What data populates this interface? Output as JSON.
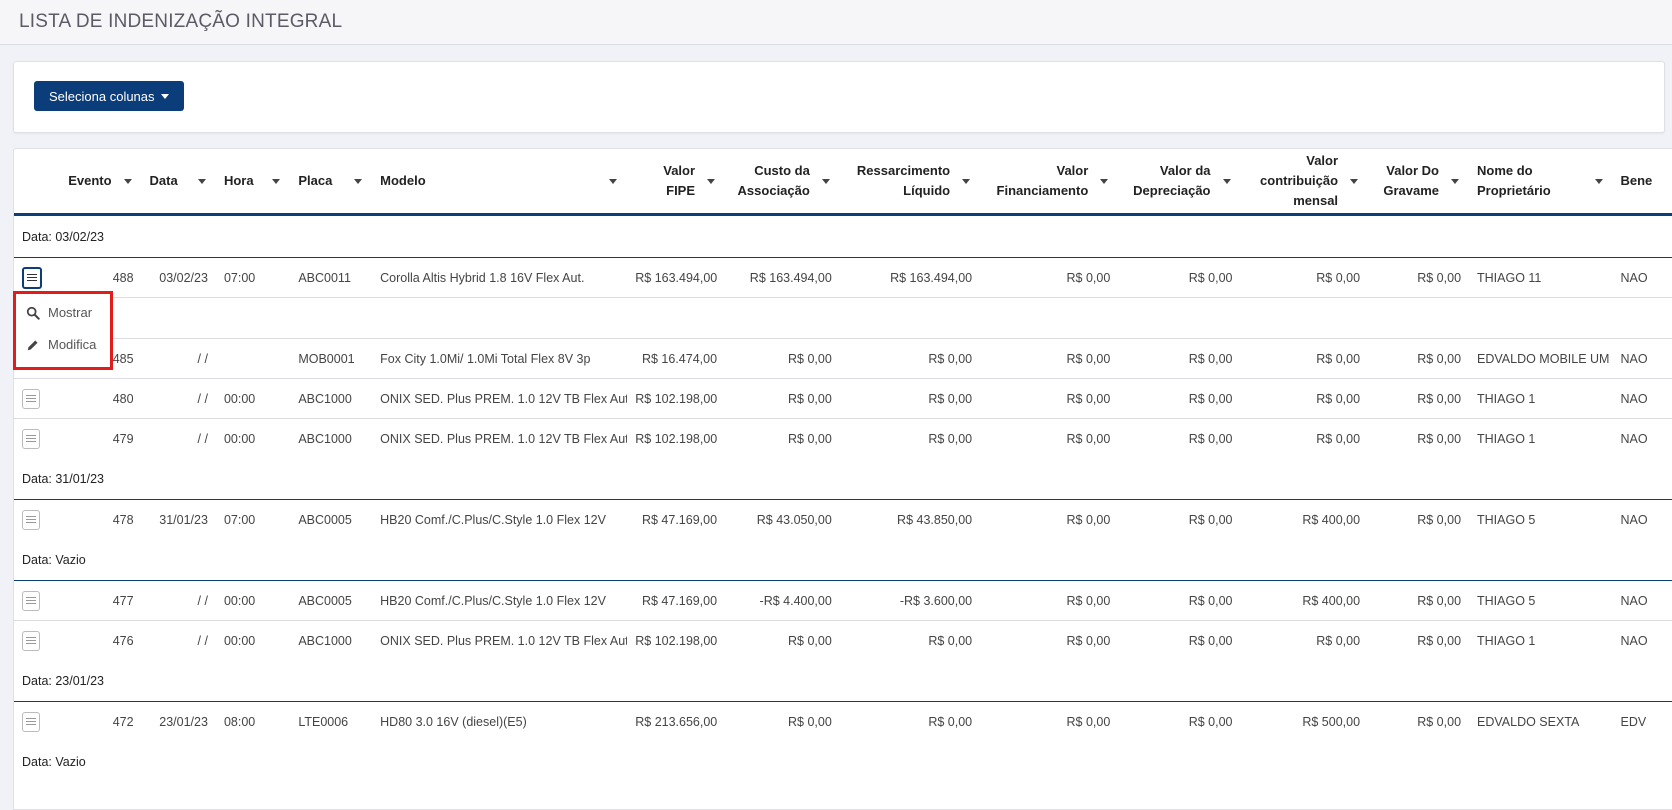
{
  "header": {
    "title": "LISTA DE INDENIZAÇÃO INTEGRAL"
  },
  "toolbar": {
    "select_columns_label": "Seleciona colunas"
  },
  "table": {
    "columns": [
      {
        "label": "Evento"
      },
      {
        "label": "Data"
      },
      {
        "label": "Hora"
      },
      {
        "label": "Placa"
      },
      {
        "label": "Modelo"
      },
      {
        "label": "Valor FIPE"
      },
      {
        "label": "Custo da Associação"
      },
      {
        "label": "Ressarcimento Líquido"
      },
      {
        "label": "Valor Financiamento"
      },
      {
        "label": "Valor da Depreciação"
      },
      {
        "label": "Valor contribuição mensal"
      },
      {
        "label": "Valor Do Gravame"
      },
      {
        "label": "Nome do Proprietário"
      },
      {
        "label": "Bene"
      }
    ],
    "groups": [
      {
        "label": "Data: 03/02/23",
        "rows": [
          {
            "evento": "488",
            "data": "03/02/23",
            "hora": "07:00",
            "placa": "ABC0011",
            "modelo": "Corolla Altis Hybrid 1.8 16V Flex Aut.",
            "fipe": "R$ 163.494,00",
            "custo": "R$ 163.494,00",
            "ressarc": "R$ 163.494,00",
            "financ": "R$ 0,00",
            "deprec": "R$ 0,00",
            "contrib": "R$ 0,00",
            "gravame": "R$ 0,00",
            "nome": "THIAGO 11",
            "bene": "NAO"
          },
          {
            "evento": "",
            "data": "",
            "hora": "",
            "placa": "",
            "modelo": "",
            "fipe": "",
            "custo": "",
            "ressarc": "",
            "financ": "",
            "deprec": "",
            "contrib": "",
            "gravame": "",
            "nome": "",
            "bene": ""
          },
          {
            "evento": "485",
            "data": "/ /",
            "hora": "",
            "placa": "MOB0001",
            "modelo": "Fox City 1.0Mi/ 1.0Mi Total Flex 8V 3p",
            "fipe": "R$ 16.474,00",
            "custo": "R$ 0,00",
            "ressarc": "R$ 0,00",
            "financ": "R$ 0,00",
            "deprec": "R$ 0,00",
            "contrib": "R$ 0,00",
            "gravame": "R$ 0,00",
            "nome": "EDVALDO MOBILE UM",
            "bene": "NAO"
          },
          {
            "evento": "480",
            "data": "/ /",
            "hora": "00:00",
            "placa": "ABC1000",
            "modelo": "ONIX SED. Plus PREM. 1.0 12V TB Flex Aut",
            "fipe": "R$ 102.198,00",
            "custo": "R$ 0,00",
            "ressarc": "R$ 0,00",
            "financ": "R$ 0,00",
            "deprec": "R$ 0,00",
            "contrib": "R$ 0,00",
            "gravame": "R$ 0,00",
            "nome": "THIAGO 1",
            "bene": "NAO"
          },
          {
            "evento": "479",
            "data": "/ /",
            "hora": "00:00",
            "placa": "ABC1000",
            "modelo": "ONIX SED. Plus PREM. 1.0 12V TB Flex Aut",
            "fipe": "R$ 102.198,00",
            "custo": "R$ 0,00",
            "ressarc": "R$ 0,00",
            "financ": "R$ 0,00",
            "deprec": "R$ 0,00",
            "contrib": "R$ 0,00",
            "gravame": "R$ 0,00",
            "nome": "THIAGO 1",
            "bene": "NAO"
          }
        ]
      },
      {
        "label": "Data: 31/01/23",
        "rows": [
          {
            "evento": "478",
            "data": "31/01/23",
            "hora": "07:00",
            "placa": "ABC0005",
            "modelo": "HB20 Comf./C.Plus/C.Style 1.0 Flex 12V",
            "fipe": "R$ 47.169,00",
            "custo": "R$ 43.050,00",
            "ressarc": "R$ 43.850,00",
            "financ": "R$ 0,00",
            "deprec": "R$ 0,00",
            "contrib": "R$ 400,00",
            "gravame": "R$ 0,00",
            "nome": "THIAGO 5",
            "bene": "NAO"
          }
        ]
      },
      {
        "label": "Data: Vazio",
        "rows": [
          {
            "evento": "477",
            "data": "/ /",
            "hora": "00:00",
            "placa": "ABC0005",
            "modelo": "HB20 Comf./C.Plus/C.Style 1.0 Flex 12V",
            "fipe": "R$ 47.169,00",
            "custo": "-R$ 4.400,00",
            "ressarc": "-R$ 3.600,00",
            "financ": "R$ 0,00",
            "deprec": "R$ 0,00",
            "contrib": "R$ 400,00",
            "gravame": "R$ 0,00",
            "nome": "THIAGO 5",
            "bene": "NAO"
          },
          {
            "evento": "476",
            "data": "/ /",
            "hora": "00:00",
            "placa": "ABC1000",
            "modelo": "ONIX SED. Plus PREM. 1.0 12V TB Flex Aut",
            "fipe": "R$ 102.198,00",
            "custo": "R$ 0,00",
            "ressarc": "R$ 0,00",
            "financ": "R$ 0,00",
            "deprec": "R$ 0,00",
            "contrib": "R$ 0,00",
            "gravame": "R$ 0,00",
            "nome": "THIAGO 1",
            "bene": "NAO"
          }
        ]
      },
      {
        "label": "Data: 23/01/23",
        "rows": [
          {
            "evento": "472",
            "data": "23/01/23",
            "hora": "08:00",
            "placa": "LTE0006",
            "modelo": "HD80 3.0 16V (diesel)(E5)",
            "fipe": "R$ 213.656,00",
            "custo": "R$ 0,00",
            "ressarc": "R$ 0,00",
            "financ": "R$ 0,00",
            "deprec": "R$ 0,00",
            "contrib": "R$ 500,00",
            "gravame": "R$ 0,00",
            "nome": "EDVALDO SEXTA",
            "bene": "EDV"
          }
        ]
      },
      {
        "label": "Data: Vazio",
        "rows": []
      }
    ]
  },
  "context_menu": {
    "items": [
      {
        "label": "Mostrar",
        "icon": "search-icon"
      },
      {
        "label": "Modifica",
        "icon": "pencil-icon"
      }
    ]
  },
  "colors": {
    "accent": "#0b3d7a",
    "highlight": "#e21b1b"
  }
}
